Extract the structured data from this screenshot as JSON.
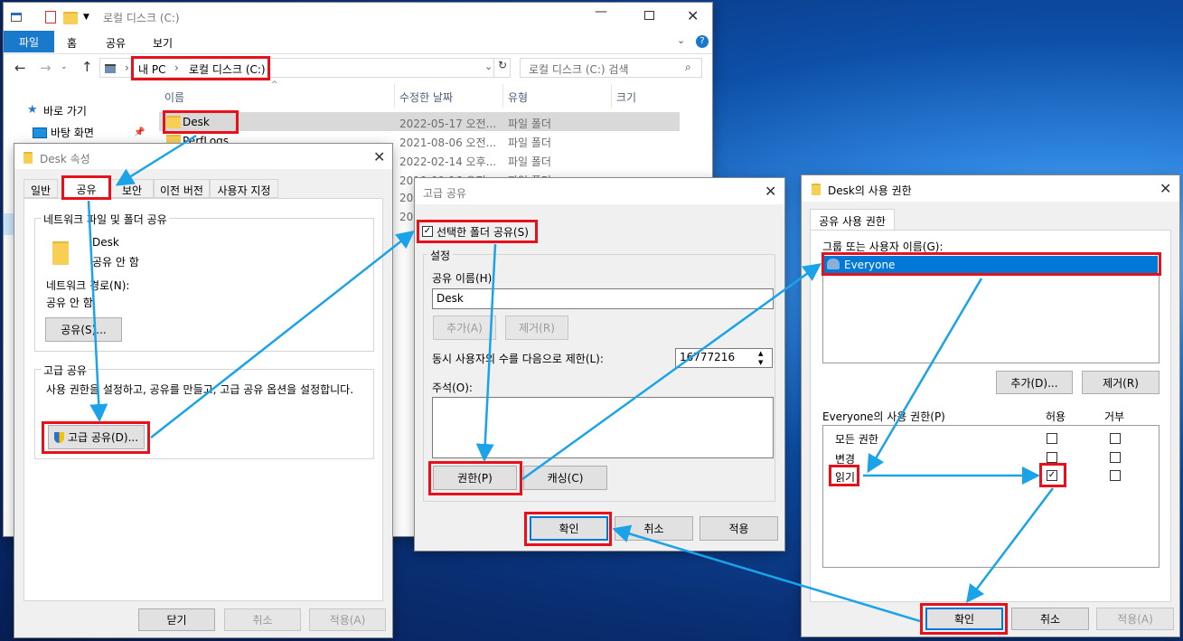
{
  "explorer": {
    "title": "로컬 디스크 (C:)",
    "ribbon_tabs": [
      "파일",
      "홈",
      "공유",
      "보기"
    ],
    "address": {
      "root": "내 PC",
      "sep": "›",
      "current": "로컬 디스크 (C:)"
    },
    "search_placeholder": "로컬 디스크 (C:) 검색",
    "nav": {
      "quick_access": "바로 가기",
      "desktop": "바탕 화면"
    },
    "columns": [
      "이름",
      "수정한 날짜",
      "유형",
      "크기"
    ],
    "rows": [
      {
        "name": "Desk",
        "date": "2022-05-17 오전...",
        "type": "파일 폴더"
      },
      {
        "name": "PerfLogs",
        "date": "2021-08-06 오전...",
        "type": "파일 폴더"
      },
      {
        "name": "",
        "date": "2022-02-14 오후...",
        "type": "파일 폴더"
      },
      {
        "name": "",
        "date": "2019-09-16 오전...",
        "type": "파일 폴더"
      },
      {
        "name": "",
        "date": "202",
        "type": ""
      },
      {
        "name": "",
        "date": "202",
        "type": ""
      }
    ]
  },
  "props": {
    "title": "Desk 속성",
    "tabs": [
      "일반",
      "공유",
      "보안",
      "이전 버전",
      "사용자 지정"
    ],
    "network_group": "네트워크 파일 및 폴더 공유",
    "folder_name": "Desk",
    "share_status": "공유 안 함",
    "network_path_label": "네트워크 경로(N):",
    "network_path_value": "공유 안 함",
    "share_button": "공유(S)...",
    "adv_group": "고급 공유",
    "adv_desc": "사용 권한을 설정하고, 공유를 만들고, 고급 공유 옵션을 설정합니다.",
    "adv_button": "고급 공유(D)...",
    "close": "닫기",
    "cancel": "취소",
    "apply": "적용(A)"
  },
  "adv": {
    "title": "고급 공유",
    "share_check": "선택한 폴더 공유(S)",
    "settings": "설정",
    "share_name_label": "공유 이름(H):",
    "share_name_value": "Desk",
    "add": "추가(A)",
    "remove": "제거(R)",
    "limit_label": "동시 사용자의 수를 다음으로 제한(L):",
    "limit_value": "16777216",
    "comment_label": "주석(O):",
    "permissions": "권한(P)",
    "caching": "캐싱(C)",
    "ok": "확인",
    "cancel": "취소",
    "apply": "적용"
  },
  "perm": {
    "title": "Desk의 사용 권한",
    "tab": "공유 사용 권한",
    "group_label": "그룹 또는 사용자 이름(G):",
    "user": "Everyone",
    "add": "추가(D)...",
    "remove": "제거(R)",
    "perm_label": "Everyone의 사용 권한(P)",
    "allow": "허용",
    "deny": "거부",
    "items": [
      {
        "name": "모든 권한",
        "allow": false,
        "deny": false
      },
      {
        "name": "변경",
        "allow": false,
        "deny": false
      },
      {
        "name": "읽기",
        "allow": true,
        "deny": false
      }
    ],
    "ok": "확인",
    "cancel": "취소",
    "apply": "적용(A)"
  },
  "colors": {
    "highlight": "#e8101a",
    "arrow": "#1aa3e8",
    "select": "#0078d7"
  }
}
